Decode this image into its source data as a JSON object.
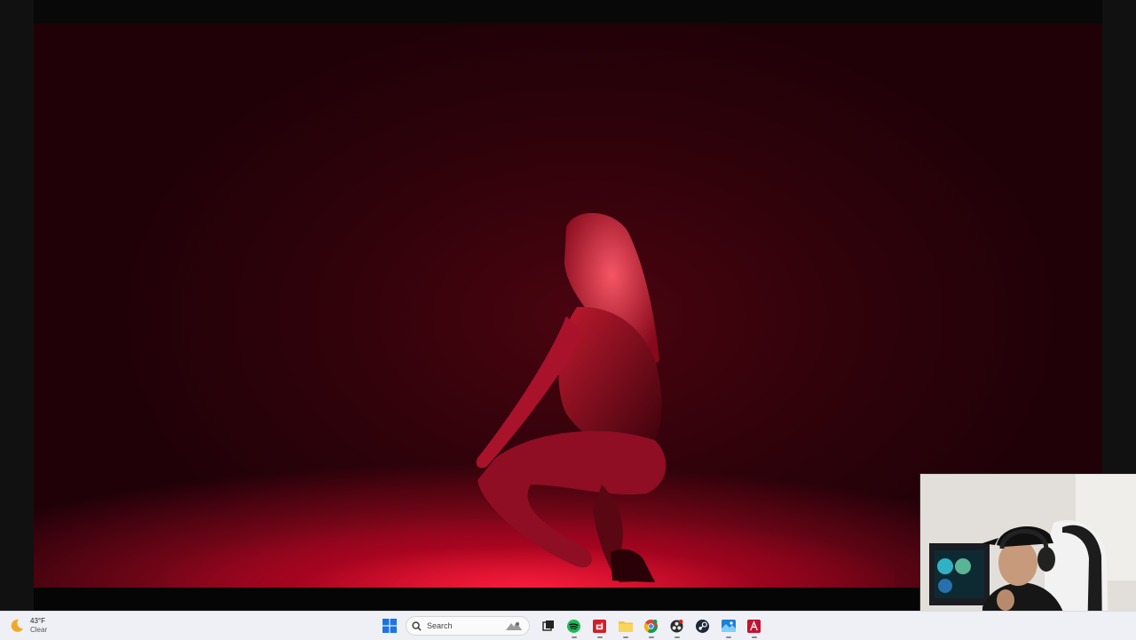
{
  "video": {
    "description_icon": "video-player"
  },
  "taskbar": {
    "weather": {
      "temperature": "43°F",
      "condition": "Clear",
      "icon": "moon-icon"
    },
    "search": {
      "placeholder": "Search"
    },
    "apps": [
      {
        "name": "start-button",
        "icon": "windows-logo-icon",
        "active": false
      },
      {
        "name": "task-view-button",
        "icon": "task-view-icon",
        "active": false
      },
      {
        "name": "spotify-button",
        "icon": "spotify-icon",
        "active": true
      },
      {
        "name": "amd-software-button",
        "icon": "amd-icon",
        "active": true
      },
      {
        "name": "file-explorer-button",
        "icon": "folder-icon",
        "active": true
      },
      {
        "name": "chrome-button",
        "icon": "chrome-icon",
        "active": true
      },
      {
        "name": "obs-button",
        "icon": "obs-icon",
        "active": true
      },
      {
        "name": "steam-button",
        "icon": "steam-icon",
        "active": false
      },
      {
        "name": "photos-button",
        "icon": "photos-icon",
        "active": true
      },
      {
        "name": "app-button",
        "icon": "red-app-icon",
        "active": true
      }
    ]
  },
  "colors": {
    "video_bg": "#2a020a",
    "stage_light": "#ff1e3c",
    "taskbar_bg": "#eef0f5",
    "spotify": "#1db954",
    "amd": "#d11f2a"
  },
  "webcam": {
    "description_icon": "webcam-overlay"
  }
}
